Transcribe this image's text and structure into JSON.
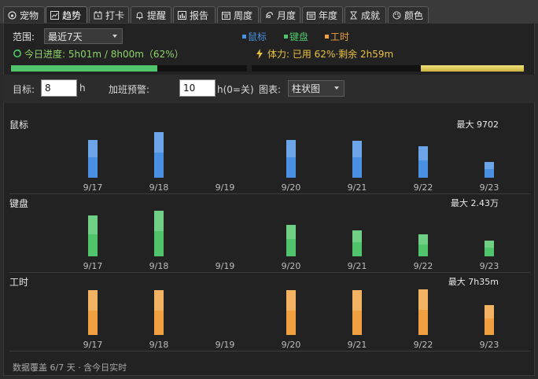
{
  "tabs": [
    {
      "label": "宠物",
      "icon": "paw-icon"
    },
    {
      "label": "趋势",
      "icon": "chart-icon",
      "active": true
    },
    {
      "label": "打卡",
      "icon": "clock-icon"
    },
    {
      "label": "提醒",
      "icon": "bell-icon"
    },
    {
      "label": "报告",
      "icon": "report-icon"
    },
    {
      "label": "周度",
      "icon": "calendar-week-icon"
    },
    {
      "label": "月度",
      "icon": "calendar-month-icon"
    },
    {
      "label": "年度",
      "icon": "calendar-year-icon"
    },
    {
      "label": "成就",
      "icon": "trophy-icon"
    },
    {
      "label": "颜色",
      "icon": "palette-icon"
    }
  ],
  "range": {
    "label": "范围:",
    "selected": "最近7天"
  },
  "legend": [
    {
      "label": "鼠标",
      "color": "#4a90e2"
    },
    {
      "label": "键盘",
      "color": "#4fc46a"
    },
    {
      "label": "工时",
      "color": "#f0a040"
    }
  ],
  "progress": {
    "text": "今日进度: 5h01m / 8h00m（62%）",
    "fraction": 0.62,
    "color": "#4fc46a"
  },
  "stamina": {
    "text": "体力: 已用 62%·剩余 2h59m",
    "fraction": 0.38,
    "color": "#e8d060"
  },
  "settings": {
    "goal_label": "目标:",
    "goal_value": "8",
    "goal_unit": "h",
    "overtime_label": "加班预警:",
    "overtime_value": "10",
    "overtime_unit": "h(0=关)",
    "chart_label": "图表:",
    "chart_type": "柱状图"
  },
  "chart_data": [
    {
      "type": "bar",
      "title": "鼠标",
      "max_label": "最大 9702",
      "color": "#4a90e2",
      "categories": [
        "9/17",
        "9/18",
        "9/19",
        "9/20",
        "9/21",
        "9/22",
        "9/23"
      ],
      "values": [
        8000,
        9702,
        0,
        8000,
        7800,
        6700,
        3300
      ],
      "ylim": [
        0,
        9702
      ]
    },
    {
      "type": "bar",
      "title": "键盘",
      "max_label": "最大 2.43万",
      "color": "#4fc46a",
      "categories": [
        "9/17",
        "9/18",
        "9/19",
        "9/20",
        "9/21",
        "9/22",
        "9/23"
      ],
      "values": [
        21600,
        24300,
        0,
        16800,
        14000,
        11800,
        8400
      ],
      "ylim": [
        0,
        24300
      ]
    },
    {
      "type": "bar",
      "title": "工时",
      "max_label": "最大 7h35m",
      "color": "#f0a040",
      "categories": [
        "9/17",
        "9/18",
        "9/19",
        "9/20",
        "9/21",
        "9/22",
        "9/23"
      ],
      "values": [
        7.4,
        7.4,
        0,
        7.4,
        7.4,
        7.58,
        5.0
      ],
      "ylim": [
        0,
        7.58
      ]
    }
  ],
  "footer": "数据覆盖 6/7 天 · 含今日实时"
}
